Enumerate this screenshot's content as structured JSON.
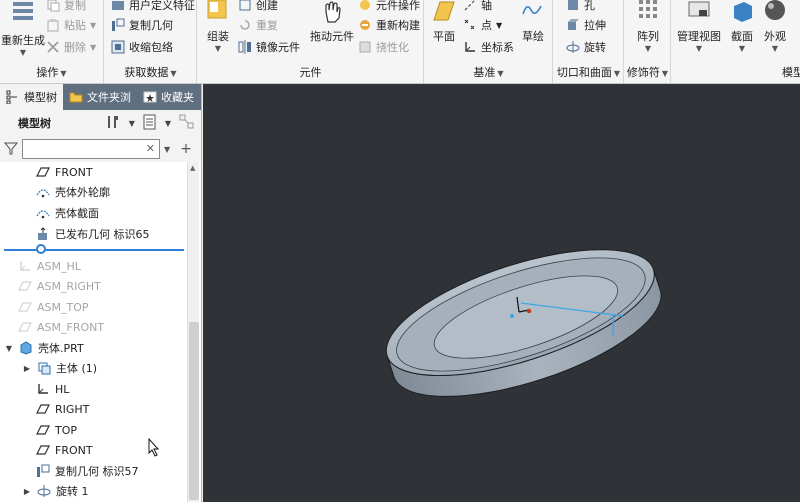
{
  "ribbon": {
    "groups": {
      "operations": {
        "label": "操作",
        "commands": {
          "copy": "复制",
          "paste": "粘贴",
          "delete": "删除",
          "regenerate": "重新生成"
        }
      },
      "get_data": {
        "label": "获取数据",
        "commands": {
          "udf": "用户定义特征",
          "copy_geom": "复制几何",
          "shrinkwrap": "收缩包络"
        }
      },
      "component": {
        "label": "元件",
        "commands": {
          "assemble": "组装",
          "create": "创建",
          "repeat": "重复",
          "mirror": "镜像元件",
          "drag": "拖动元件",
          "comp_ops": "元件操作",
          "rebuild": "重新构建",
          "flexible": "挠性化"
        }
      },
      "datum": {
        "label": "基准",
        "commands": {
          "plane": "平面",
          "axis": "轴",
          "point": "点",
          "csys": "坐标系",
          "sketch": "草绘"
        }
      },
      "cut_surface": {
        "label": "切口和曲面",
        "commands": {
          "hole": "孔",
          "extrude": "拉伸",
          "revolve": "旋转"
        }
      },
      "modifiers": {
        "label": "修饰符",
        "commands": {
          "pattern": "阵列"
        }
      },
      "model_display": {
        "label": "模型",
        "commands": {
          "manage_views": "管理视图",
          "section": "截面",
          "appearance": "外观"
        }
      }
    }
  },
  "panel": {
    "tabs": [
      {
        "label": "模型树",
        "icon": "model-tree-icon"
      },
      {
        "label": "文件夹浏",
        "icon": "folder-icon"
      },
      {
        "label": "收藏夹",
        "icon": "star-icon"
      }
    ],
    "toolbar_title": "模型树",
    "search": {
      "value": "",
      "placeholder": ""
    },
    "tree": [
      {
        "label": "FRONT",
        "icon": "datum-plane-icon",
        "dim": false
      },
      {
        "label": "壳体外轮廓",
        "icon": "sketch-icon",
        "dim": false
      },
      {
        "label": "壳体截面",
        "icon": "sketch-icon",
        "dim": false
      },
      {
        "label": "已发布几何 标识65",
        "icon": "publish-geom-icon",
        "dim": false
      },
      {
        "label": "ASM_HL",
        "icon": "csys-icon",
        "dim": true
      },
      {
        "label": "ASM_RIGHT",
        "icon": "datum-plane-icon",
        "dim": true
      },
      {
        "label": "ASM_TOP",
        "icon": "datum-plane-icon",
        "dim": true
      },
      {
        "label": "ASM_FRONT",
        "icon": "datum-plane-icon",
        "dim": true
      },
      {
        "label": "壳体.PRT",
        "icon": "part-icon",
        "dim": false
      },
      {
        "label": "主体 (1)",
        "icon": "body-icon",
        "dim": false
      },
      {
        "label": "HL",
        "icon": "csys-icon",
        "dim": false
      },
      {
        "label": "RIGHT",
        "icon": "datum-plane-icon",
        "dim": false
      },
      {
        "label": "TOP",
        "icon": "datum-plane-icon",
        "dim": false
      },
      {
        "label": "FRONT",
        "icon": "datum-plane-icon",
        "dim": false
      },
      {
        "label": "复制几何 标识57",
        "icon": "copy-geom-icon",
        "dim": false
      },
      {
        "label": "旋转 1",
        "icon": "revolve-icon",
        "dim": false
      }
    ]
  },
  "colors": {
    "accent": "#2f7ed8",
    "viewport_bg": "#2f3338",
    "tab_bar": "#5f6f80",
    "model": "#9aa6b2"
  }
}
